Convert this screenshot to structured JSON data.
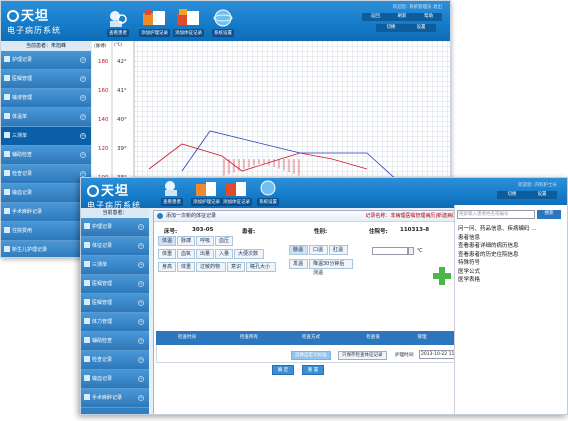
{
  "back": {
    "logo_title": "天坦",
    "logo_sub": "电子病历系统",
    "toolbar": [
      "查看患者",
      "添加护理记录",
      "添加体征记录",
      "系统设置"
    ],
    "top_right": {
      "line1": "欢迎您: 系统管理员 退出",
      "btn1": "返回",
      "btn2": "刷新",
      "btn3": "帮助",
      "btn4": "切换",
      "btn5": "设置"
    },
    "sidebar_title": "当前患者：朱旭峰",
    "sidebar": [
      "护理记录",
      "医嘱管理",
      "输液管理",
      "体温单",
      "三测单",
      "辅助检查",
      "检查记录",
      "输血记录",
      "手术麻醉记录",
      "住院费用",
      "新生儿护理记录"
    ],
    "temp_header": [
      "(脉搏)",
      "(℃)"
    ],
    "temp_labels": [
      "180",
      "42°",
      "160",
      "41°",
      "140",
      "40°",
      "120",
      "39°",
      "100",
      "38°"
    ]
  },
  "front": {
    "logo_title": "天坦",
    "logo_sub": "电子病历系统",
    "toolbar": [
      "查看患者",
      "添加护理记录",
      "添加体征记录",
      "系统设置"
    ],
    "top_right": {
      "line1": "欢迎您: 内科护士长",
      "btn1": "切换",
      "btn2": "设置"
    },
    "sidebar_title": "当前患者：",
    "sidebar": [
      "护理记录",
      "体征记录",
      "三测单",
      "医嘱管理",
      "医嘱管理",
      "体力管理",
      "辅助检查",
      "检查记录",
      "输血记录",
      "手术麻醉记录"
    ],
    "dialog": {
      "title": "添加一次新的体征记录",
      "org": "记录名称：非病理医嘱管理病历|新建病历",
      "bed_label": "床号:",
      "bed_value": "303-05",
      "patient_label": "患者:",
      "gender_label": "性别:",
      "admit_label": "住院号:",
      "admit_value": "110313-8",
      "tabs_row1": [
        "体温",
        "脉搏",
        "呼吸",
        "血压"
      ],
      "tabs_row2": [
        "体重",
        "血氧",
        "出量",
        "入量",
        "大便次数"
      ],
      "tabs_row3": [
        "身高",
        "体重",
        "过敏药物",
        "意识",
        "瞳孔大小"
      ],
      "opt_row1": [
        "腋温",
        "口温",
        "肛温"
      ],
      "opt_row2": [
        "发温",
        "降温30分钟后测温"
      ],
      "temp_unit": "℃",
      "table_headers": [
        "检查时间",
        "检查所有",
        "检查方式",
        "检查值",
        "管理"
      ],
      "filter_btn": "选择自定义标准",
      "save_btn": "只保存检查体征记录",
      "nurse_time_label": "护理时间:",
      "nurse_time_value": "2013-10-22 11:58:01",
      "ok_btn": "确 定",
      "cancel_btn": "重 置"
    },
    "right_panel": {
      "search_placeholder": "搜索输入患者姓名或编号",
      "search_btn": "搜索",
      "items": [
        "问一问、药品信息、疾病编码 ...",
        "患者信息",
        "查看患者详细的病历信息",
        "查看患者的历史住院信息",
        "特殊符号",
        "医学公式",
        "医学表格"
      ]
    }
  },
  "colors": {
    "header_blue": "#157bc8",
    "sidebar_blue": "#2f7fc1",
    "accent_green": "#4cb748",
    "chart_red": "#d0182a",
    "chart_blue": "#2a3bbd"
  }
}
